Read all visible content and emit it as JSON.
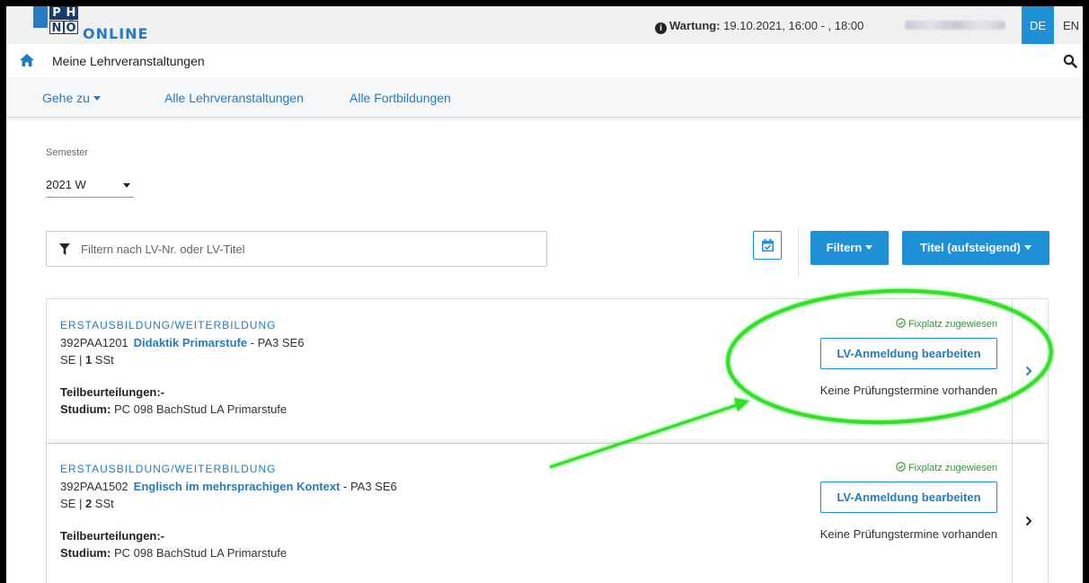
{
  "header": {
    "logo_cells": [
      "P",
      "H",
      "N",
      "Ö"
    ],
    "logo_text": "ONLINE",
    "maintenance_label": "Wartung:",
    "maintenance_time": " 19.10.2021, 16:00 - , 18:00",
    "lang_de": "DE",
    "lang_en": "EN"
  },
  "breadcrumb": {
    "title": "Meine Lehrveranstaltungen"
  },
  "nav": {
    "goto": "Gehe zu",
    "all_courses": "Alle Lehrveranstaltungen",
    "all_trainings": "Alle Fortbildungen"
  },
  "semester": {
    "label": "Semester",
    "value": "2021 W"
  },
  "filter": {
    "placeholder": "Filtern nach LV-Nr. oder LV-Titel",
    "filter_button": "Filtern",
    "sort_button": "Titel (aufsteigend)"
  },
  "courses": [
    {
      "category": "ERSTAUSBILDUNG/WEITERBILDUNG",
      "number": "392PAA1201",
      "title": "Didaktik Primarstufe",
      "suffix": " - PA3 SE6",
      "type": "SE | ",
      "hours": "1",
      "hours_unit": " SSt",
      "partial_label": "Teilbeurteilungen:-",
      "study_label": "Studium:",
      "study_value": " PC 098 BachStud LA Primarstufe",
      "status": "Fixplatz zugewiesen",
      "action": "LV-Anmeldung bearbeiten",
      "exam_info": "Keine Prüfungstermine vorhanden"
    },
    {
      "category": "ERSTAUSBILDUNG/WEITERBILDUNG",
      "number": "392PAA1502",
      "title": "Englisch im mehrsprachigen Kontext",
      "suffix": " - PA3 SE6",
      "type": "SE | ",
      "hours": "2",
      "hours_unit": " SSt",
      "partial_label": "Teilbeurteilungen:-",
      "study_label": "Studium:",
      "study_value": " PC 098 BachStud LA Primarstufe",
      "status": "Fixplatz zugewiesen",
      "action": "LV-Anmeldung bearbeiten",
      "exam_info": "Keine Prüfungstermine vorhanden"
    }
  ],
  "colors": {
    "accent": "#1f8fd6",
    "link": "#1f7ec1",
    "annotation": "#33e02a",
    "status_green": "#3e8e3e"
  }
}
